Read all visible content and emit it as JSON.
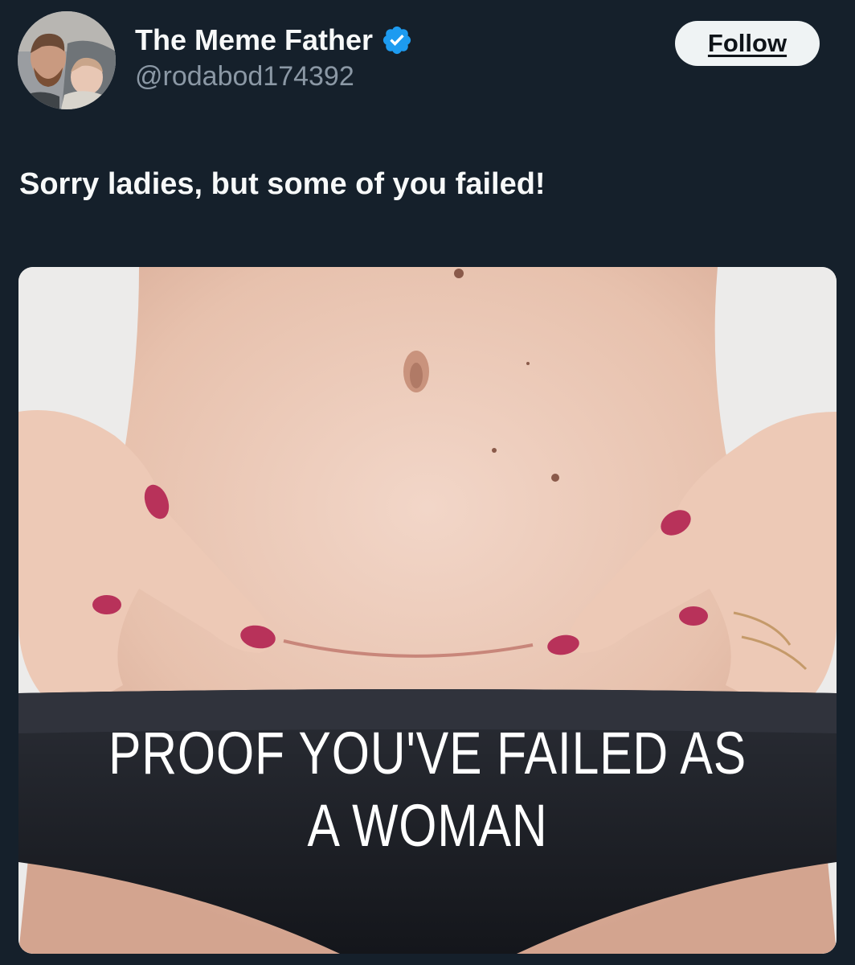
{
  "author": {
    "display_name": "The Meme Father",
    "handle": "@rodabod174392",
    "verified": true,
    "avatar_icon": "avatar-photo-icon",
    "verified_icon": "verified-badge-icon",
    "verified_color": "#1d9bf0"
  },
  "follow_button": {
    "label": "Follow"
  },
  "tweet": {
    "text": "Sorry ladies, but some of you failed!"
  },
  "media": {
    "caption_line_1": "PROOF YOU'VE FAILED AS",
    "caption_line_2": "A WOMAN"
  },
  "colors": {
    "background": "#15202b",
    "text_primary": "#f7f9f9",
    "text_secondary": "#8b98a5",
    "button_bg": "#eff3f4"
  }
}
